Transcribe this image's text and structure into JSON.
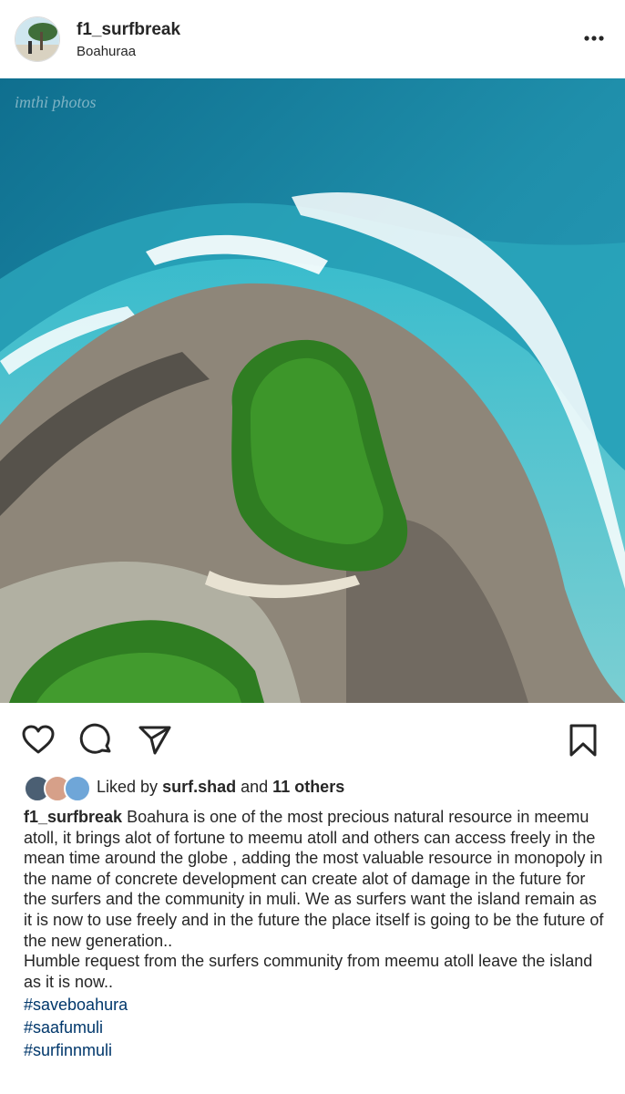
{
  "post": {
    "username": "f1_surfbreak",
    "location": "Boahuraa",
    "watermark": "imthi photos"
  },
  "likes": {
    "prefix": "Liked by",
    "user": "surf.shad",
    "conjunction": "and",
    "others": "11 others"
  },
  "caption": {
    "author": "f1_surfbreak",
    "paragraph1": "Boahura is one of the most precious natural resource in meemu atoll, it brings alot of fortune to meemu atoll and others can access freely in the mean time around the globe , adding the most valuable resource in monopoly in the name of concrete development can create alot of damage  in the future for the surfers and the community in muli. We as surfers want the island remain as it is now to use freely and in the future the place itself is going to be the future of the new generation..",
    "paragraph2": "Humble request from the surfers community from meemu atoll leave the island as it is now..",
    "hashtags": [
      "#saveboahura",
      "#saafumuli",
      "#surfinnmuli"
    ]
  },
  "colors": {
    "text": "#262626",
    "hashtag": "#00376b",
    "ocean_deep": "#1a7f9c",
    "ocean_light": "#2fa6bd",
    "reef": "#8f8577",
    "vegetation": "#2f7d22"
  },
  "icons": [
    "more-options-icon",
    "heart-icon",
    "comment-icon",
    "share-icon",
    "bookmark-icon"
  ]
}
